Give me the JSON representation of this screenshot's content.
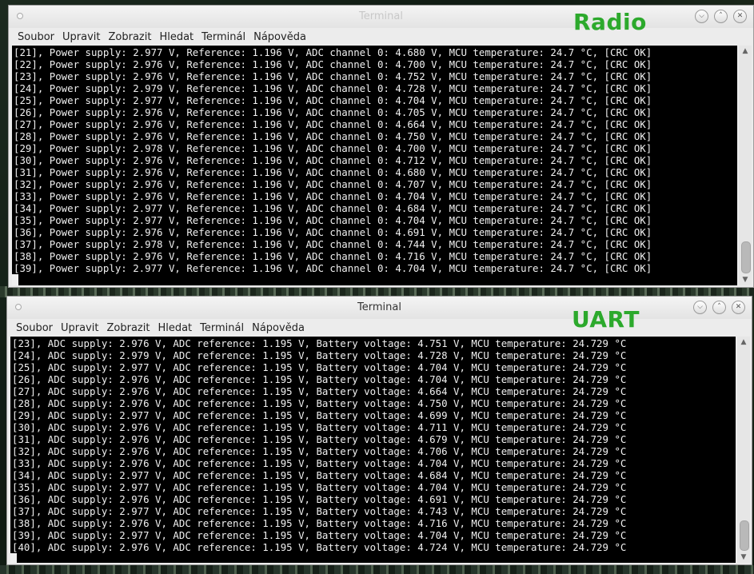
{
  "background": {
    "accent": "#2ca92c"
  },
  "windows": [
    {
      "title": "Terminal",
      "label": "Radio",
      "menu": [
        "Soubor",
        "Upravit",
        "Zobrazit",
        "Hledat",
        "Terminál",
        "Nápověda"
      ],
      "lines": [
        "[21], Power supply: 2.977 V, Reference: 1.196 V, ADC channel 0: 4.680 V, MCU temperature: 24.7 °C, [CRC OK]",
        "[22], Power supply: 2.976 V, Reference: 1.196 V, ADC channel 0: 4.700 V, MCU temperature: 24.7 °C, [CRC OK]",
        "[23], Power supply: 2.976 V, Reference: 1.196 V, ADC channel 0: 4.752 V, MCU temperature: 24.7 °C, [CRC OK]",
        "[24], Power supply: 2.979 V, Reference: 1.196 V, ADC channel 0: 4.728 V, MCU temperature: 24.7 °C, [CRC OK]",
        "[25], Power supply: 2.977 V, Reference: 1.196 V, ADC channel 0: 4.704 V, MCU temperature: 24.7 °C, [CRC OK]",
        "[26], Power supply: 2.976 V, Reference: 1.196 V, ADC channel 0: 4.705 V, MCU temperature: 24.7 °C, [CRC OK]",
        "[27], Power supply: 2.976 V, Reference: 1.196 V, ADC channel 0: 4.664 V, MCU temperature: 24.7 °C, [CRC OK]",
        "[28], Power supply: 2.976 V, Reference: 1.196 V, ADC channel 0: 4.750 V, MCU temperature: 24.7 °C, [CRC OK]",
        "[29], Power supply: 2.978 V, Reference: 1.196 V, ADC channel 0: 4.700 V, MCU temperature: 24.7 °C, [CRC OK]",
        "[30], Power supply: 2.976 V, Reference: 1.196 V, ADC channel 0: 4.712 V, MCU temperature: 24.7 °C, [CRC OK]",
        "[31], Power supply: 2.976 V, Reference: 1.196 V, ADC channel 0: 4.680 V, MCU temperature: 24.7 °C, [CRC OK]",
        "[32], Power supply: 2.976 V, Reference: 1.196 V, ADC channel 0: 4.707 V, MCU temperature: 24.7 °C, [CRC OK]",
        "[33], Power supply: 2.976 V, Reference: 1.196 V, ADC channel 0: 4.704 V, MCU temperature: 24.7 °C, [CRC OK]",
        "[34], Power supply: 2.977 V, Reference: 1.196 V, ADC channel 0: 4.684 V, MCU temperature: 24.7 °C, [CRC OK]",
        "[35], Power supply: 2.977 V, Reference: 1.196 V, ADC channel 0: 4.704 V, MCU temperature: 24.7 °C, [CRC OK]",
        "[36], Power supply: 2.976 V, Reference: 1.196 V, ADC channel 0: 4.691 V, MCU temperature: 24.7 °C, [CRC OK]",
        "[37], Power supply: 2.978 V, Reference: 1.196 V, ADC channel 0: 4.744 V, MCU temperature: 24.7 °C, [CRC OK]",
        "[38], Power supply: 2.976 V, Reference: 1.196 V, ADC channel 0: 4.716 V, MCU temperature: 24.7 °C, [CRC OK]",
        "[39], Power supply: 2.977 V, Reference: 1.196 V, ADC channel 0: 4.704 V, MCU temperature: 24.7 °C, [CRC OK]"
      ]
    },
    {
      "title": "Terminal",
      "label": "UART",
      "menu": [
        "Soubor",
        "Upravit",
        "Zobrazit",
        "Hledat",
        "Terminál",
        "Nápověda"
      ],
      "lines": [
        "[23], ADC supply: 2.976 V, ADC reference: 1.195 V, Battery voltage: 4.751 V, MCU temperature: 24.729 °C",
        "[24], ADC supply: 2.979 V, ADC reference: 1.195 V, Battery voltage: 4.728 V, MCU temperature: 24.729 °C",
        "[25], ADC supply: 2.977 V, ADC reference: 1.195 V, Battery voltage: 4.704 V, MCU temperature: 24.729 °C",
        "[26], ADC supply: 2.976 V, ADC reference: 1.195 V, Battery voltage: 4.704 V, MCU temperature: 24.729 °C",
        "[27], ADC supply: 2.976 V, ADC reference: 1.195 V, Battery voltage: 4.664 V, MCU temperature: 24.729 °C",
        "[28], ADC supply: 2.976 V, ADC reference: 1.195 V, Battery voltage: 4.750 V, MCU temperature: 24.729 °C",
        "[29], ADC supply: 2.977 V, ADC reference: 1.195 V, Battery voltage: 4.699 V, MCU temperature: 24.729 °C",
        "[30], ADC supply: 2.976 V, ADC reference: 1.195 V, Battery voltage: 4.711 V, MCU temperature: 24.729 °C",
        "[31], ADC supply: 2.976 V, ADC reference: 1.195 V, Battery voltage: 4.679 V, MCU temperature: 24.729 °C",
        "[32], ADC supply: 2.976 V, ADC reference: 1.195 V, Battery voltage: 4.706 V, MCU temperature: 24.729 °C",
        "[33], ADC supply: 2.976 V, ADC reference: 1.195 V, Battery voltage: 4.704 V, MCU temperature: 24.729 °C",
        "[34], ADC supply: 2.977 V, ADC reference: 1.195 V, Battery voltage: 4.684 V, MCU temperature: 24.729 °C",
        "[35], ADC supply: 2.977 V, ADC reference: 1.195 V, Battery voltage: 4.704 V, MCU temperature: 24.729 °C",
        "[36], ADC supply: 2.976 V, ADC reference: 1.195 V, Battery voltage: 4.691 V, MCU temperature: 24.729 °C",
        "[37], ADC supply: 2.977 V, ADC reference: 1.195 V, Battery voltage: 4.743 V, MCU temperature: 24.729 °C",
        "[38], ADC supply: 2.976 V, ADC reference: 1.195 V, Battery voltage: 4.716 V, MCU temperature: 24.729 °C",
        "[39], ADC supply: 2.977 V, ADC reference: 1.195 V, Battery voltage: 4.704 V, MCU temperature: 24.729 °C",
        "[40], ADC supply: 2.976 V, ADC reference: 1.195 V, Battery voltage: 4.724 V, MCU temperature: 24.729 °C"
      ]
    }
  ]
}
